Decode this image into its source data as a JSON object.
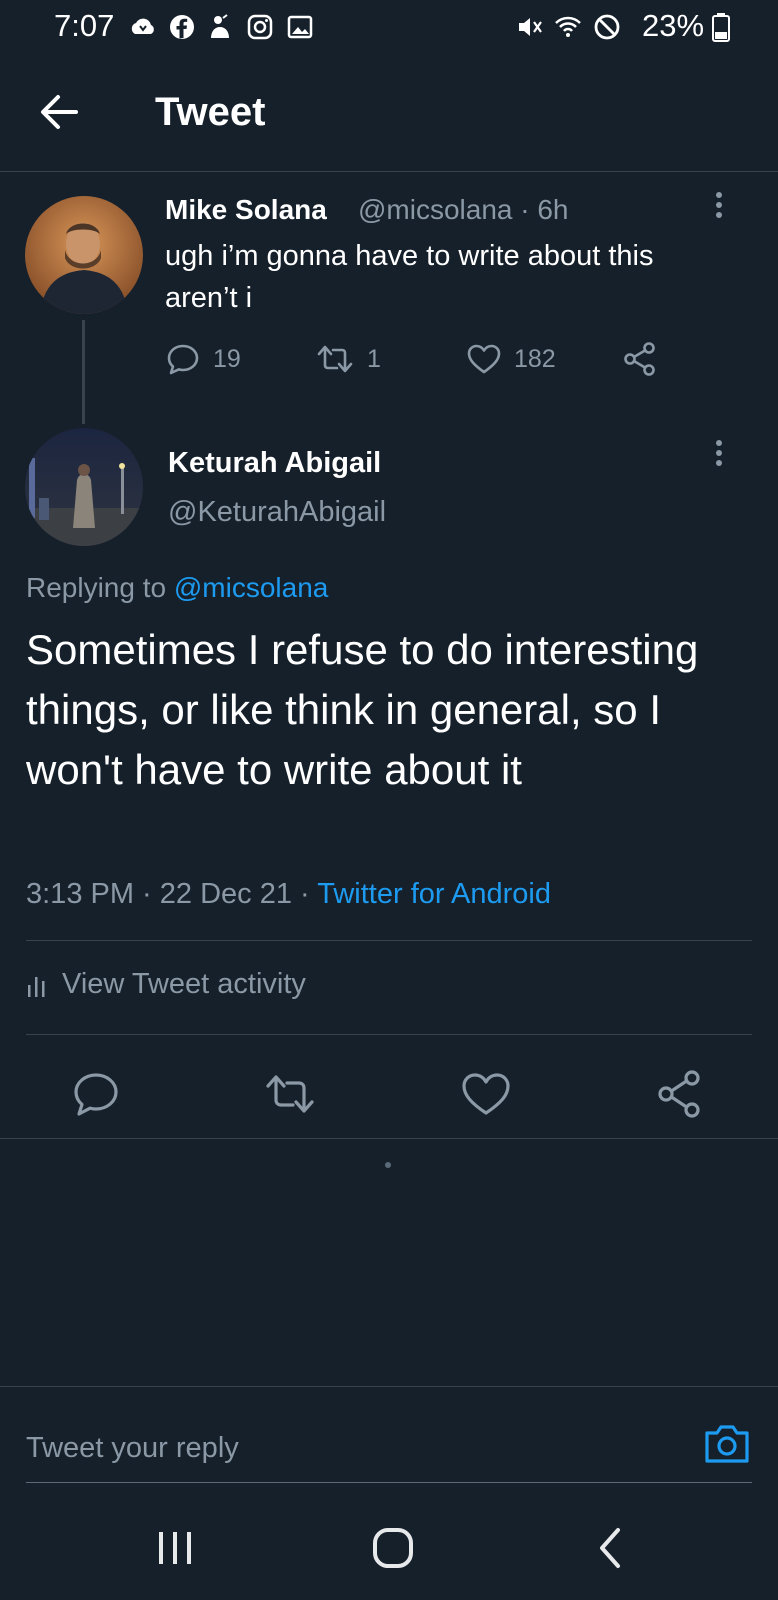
{
  "status_bar": {
    "time": "7:07",
    "battery": "23%"
  },
  "header": {
    "title": "Tweet"
  },
  "parent_tweet": {
    "name": "Mike Solana",
    "handle_time": "@micsolana · 6h",
    "text": "ugh i’m gonna have to write about this aren’t i",
    "replies": "19",
    "retweets": "1",
    "likes": "182"
  },
  "reply_tweet": {
    "name": "Keturah Abigail",
    "handle": "@KeturahAbigail",
    "replying_prefix": "Replying to",
    "replying_to": "@micsolana",
    "text": "Sometimes I refuse to do interesting things, or like think in general, so I won't have to write about it",
    "time": "3:13 PM · 22 Dec 21 ·",
    "source": "Twitter for Android",
    "activity_label": "View Tweet activity"
  },
  "composer": {
    "placeholder": "Tweet your reply"
  },
  "icons": {
    "back": "arrow-left-icon",
    "reply": "speech-bubble-icon",
    "retweet": "retweet-icon",
    "like": "heart-icon",
    "share": "share-icon",
    "camera": "camera-icon",
    "more": "kebab-icon"
  },
  "colors": {
    "background": "#15202b",
    "accent": "#1d9bf0",
    "muted": "#8b98a5",
    "divider": "#38444d"
  }
}
